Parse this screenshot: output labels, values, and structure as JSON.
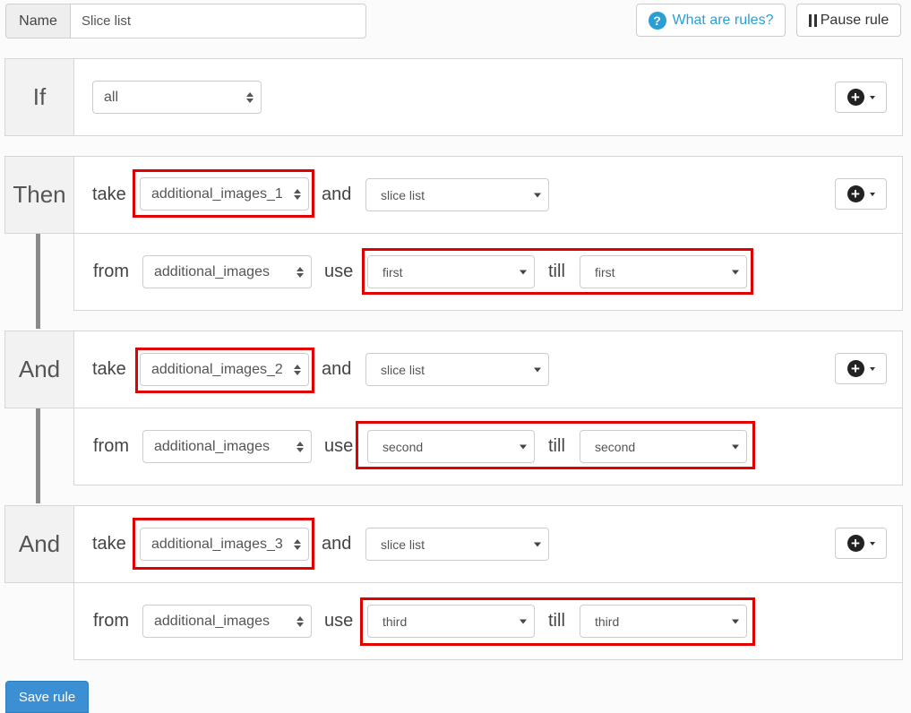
{
  "header": {
    "name_label": "Name",
    "name_value": "Slice list",
    "help_label": "What are rules?",
    "help_icon": "?",
    "pause_label": "Pause rule"
  },
  "if_block": {
    "label": "If",
    "condition": "all"
  },
  "blocks": [
    {
      "label": "Then",
      "take": "take",
      "field": "additional_images_1",
      "and": "and",
      "action": "slice list",
      "from": "from",
      "source": "additional_images",
      "use": "use",
      "start": "first",
      "till": "till",
      "end": "first"
    },
    {
      "label": "And",
      "take": "take",
      "field": "additional_images_2",
      "and": "and",
      "action": "slice list",
      "from": "from",
      "source": "additional_images",
      "use": "use",
      "start": "second",
      "till": "till",
      "end": "second"
    },
    {
      "label": "And",
      "take": "take",
      "field": "additional_images_3",
      "and": "and",
      "action": "slice list",
      "from": "from",
      "source": "additional_images",
      "use": "use",
      "start": "third",
      "till": "till",
      "end": "third"
    }
  ],
  "footer": {
    "save_label": "Save rule"
  },
  "colors": {
    "accent": "#2a9fd6",
    "save": "#3c8fd3",
    "highlight": "#e00000"
  }
}
